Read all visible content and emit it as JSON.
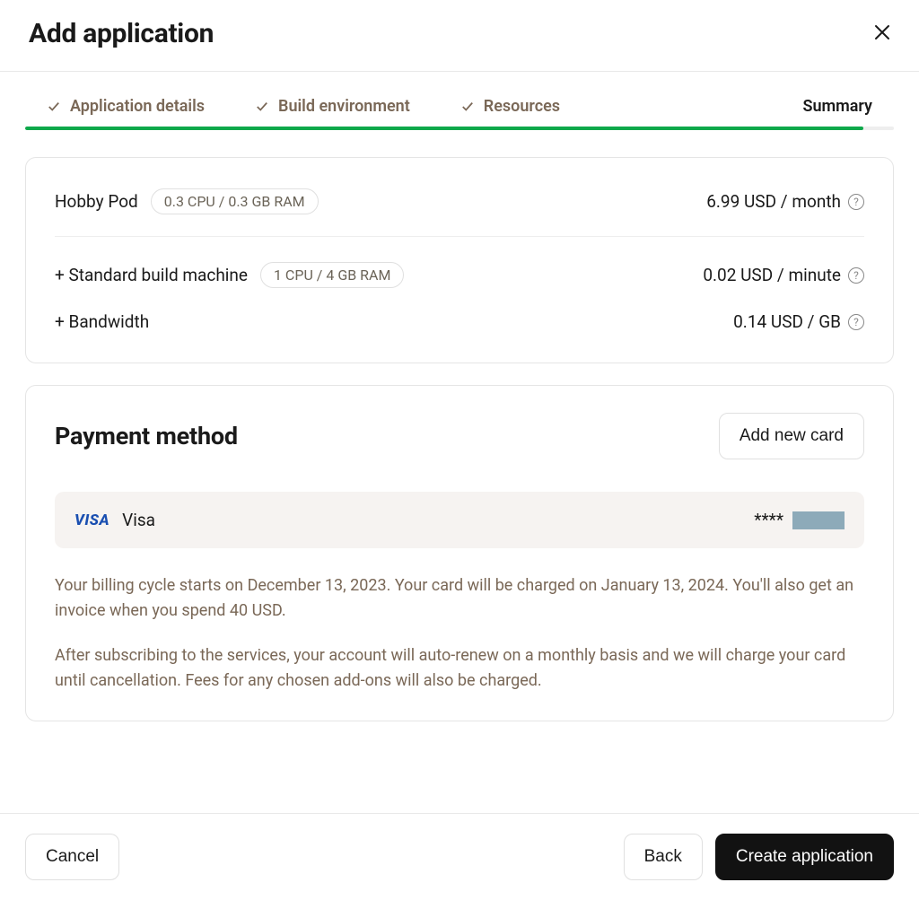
{
  "header": {
    "title": "Add application"
  },
  "steps": [
    {
      "label": "Application details",
      "done": true
    },
    {
      "label": "Build environment",
      "done": true
    },
    {
      "label": "Resources",
      "done": true
    },
    {
      "label": "Summary",
      "active": true
    }
  ],
  "summary": {
    "items": [
      {
        "label": "Hobby Pod",
        "specs": "0.3 CPU / 0.3 GB RAM",
        "price": "6.99 USD / month"
      },
      {
        "label": "+ Standard build machine",
        "specs": "1 CPU / 4 GB RAM",
        "price": "0.02 USD / minute"
      },
      {
        "label": "+ Bandwidth",
        "specs": "",
        "price": "0.14 USD / GB"
      }
    ]
  },
  "payment": {
    "title": "Payment method",
    "add_card_label": "Add new card",
    "card": {
      "brand_logo": "VISA",
      "brand": "Visa",
      "mask": "****"
    },
    "note1": "Your billing cycle starts on December 13, 2023. Your card will be charged on January 13, 2024. You'll also get an invoice when you spend 40 USD.",
    "note2": "After subscribing to the services, your account will auto-renew on a monthly basis and we will charge your card until cancellation. Fees for any chosen add-ons will also be charged."
  },
  "footer": {
    "cancel": "Cancel",
    "back": "Back",
    "create": "Create application"
  }
}
